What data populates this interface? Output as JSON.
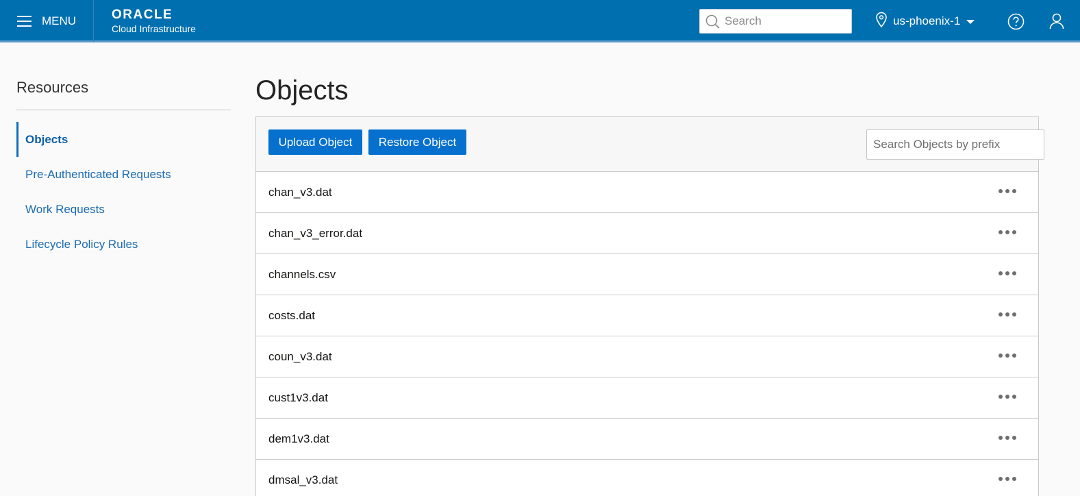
{
  "header": {
    "menu_label": "MENU",
    "brand_logo": "ORACLE",
    "brand_sub": "Cloud Infrastructure",
    "search_placeholder": "Search",
    "region": "us-phoenix-1",
    "icons": {
      "menu": "hamburger-icon",
      "search": "search-icon",
      "region": "location-pin-icon",
      "region_caret": "caret-down-icon",
      "help": "help-icon",
      "user": "user-icon"
    }
  },
  "colors": {
    "header_bg": "#006fb0",
    "button_bg": "#0670ce",
    "link": "#1b6bb2"
  },
  "sidebar": {
    "title": "Resources",
    "items": [
      {
        "label": "Objects",
        "active": true
      },
      {
        "label": "Pre-Authenticated Requests",
        "active": false
      },
      {
        "label": "Work Requests",
        "active": false
      },
      {
        "label": "Lifecycle Policy Rules",
        "active": false
      }
    ]
  },
  "main": {
    "title": "Objects",
    "upload_label": "Upload Object",
    "restore_label": "Restore Object",
    "prefix_placeholder": "Search Objects by prefix",
    "objects": [
      "chan_v3.dat",
      "chan_v3_error.dat",
      "channels.csv",
      "costs.dat",
      "coun_v3.dat",
      "cust1v3.dat",
      "dem1v3.dat",
      "dmsal_v3.dat"
    ]
  }
}
